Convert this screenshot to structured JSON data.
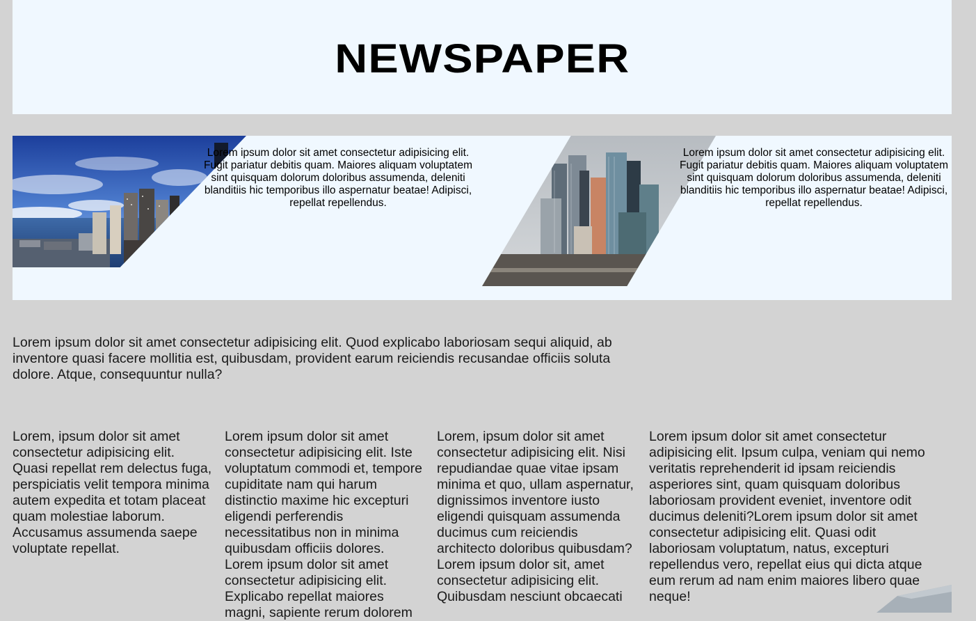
{
  "header": {
    "title": "NEWSPAPER"
  },
  "featured": [
    {
      "image": "seattle-skyline-photo",
      "text": "Lorem ipsum dolor sit amet consectetur adipisicing elit. Fugit pariatur debitis quam. Maiores aliquam voluptatem sint quisquam dolorum doloribus assumenda, deleniti blanditiis hic temporibus illo aspernatur beatae! Adipisci, repellat repellendus."
    },
    {
      "image": "moscow-city-towers-photo",
      "text": "Lorem ipsum dolor sit amet consectetur adipisicing elit. Fugit pariatur debitis quam. Maiores aliquam voluptatem sint quisquam dolorum doloribus assumenda, deleniti blanditiis hic temporibus illo aspernatur beatae! Adipisci, repellat repellendus."
    }
  ],
  "lead": "Lorem ipsum dolor sit amet consectetur adipisicing elit. Quod explicabo laboriosam sequi aliquid, ab inventore quasi facere mollitia est, quibusdam, provident earum reiciendis recusandae officiis soluta dolore. Atque, consequuntur nulla?",
  "columns": [
    "Lorem, ipsum dolor sit amet consectetur adipisicing elit. Quasi repellat rem delectus fuga, perspiciatis velit tempora minima autem expedita et totam placeat quam molestiae laborum. Accusamus assumenda saepe voluptate repellat.",
    "Lorem ipsum dolor sit amet consectetur adipisicing elit. Iste voluptatum commodi et, tempore cupiditate nam qui harum distinctio maxime hic excepturi eligendi perferendis necessitatibus non in minima quibusdam officiis dolores. Lorem ipsum dolor sit amet consectetur adipisicing elit. Explicabo repellat maiores magni, sapiente rerum dolorem",
    "Lorem, ipsum dolor sit amet consectetur adipisicing elit. Nisi repudiandae quae vitae ipsam minima et quo, ullam aspernatur, dignissimos inventore iusto eligendi quisquam assumenda ducimus cum reiciendis architecto doloribus quibusdam?Lorem ipsum dolor sit, amet consectetur adipisicing elit. Quibusdam nesciunt obcaecati",
    "Lorem ipsum dolor sit amet consectetur adipisicing elit. Ipsum culpa, veniam qui nemo veritatis reprehenderit id ipsam reiciendis asperiores sint, quam quisquam doloribus laboriosam provident eveniet, inventore odit ducimus deleniti?Lorem ipsum dolor sit amet consectetur adipisicing elit. Quasi odit laboriosam voluptatum, natus, excepturi repellendus vero, repellat eius qui dicta atque eum rerum ad nam enim maiores libero quae neque!"
  ],
  "colors": {
    "page_background": "#d3d3d3",
    "panel_background": "#f0f8ff",
    "text": "#1a1a1a"
  }
}
